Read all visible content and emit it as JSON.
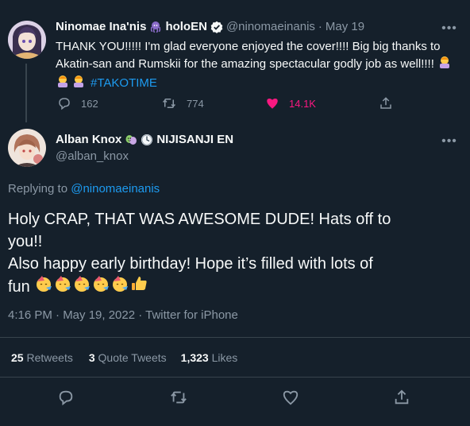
{
  "parent_tweet": {
    "display_name": "Ninomae Ina'nis",
    "name_suffix": "holoEN",
    "handle": "@ninomaeinanis",
    "date": "May 19",
    "text_line1": "THANK YOU!!!!! I'm glad everyone enjoyed the cover!!!! Big big thanks to",
    "text_line2": "Akatin-san and Rumskii for the amazing spectacular godly job as well!!!!",
    "hashtag": "#TAKOTIME",
    "replies": "162",
    "retweets": "774",
    "likes": "14.1K"
  },
  "reply_tweet": {
    "display_name": "Alban Knox",
    "name_suffix": "NIJISANJI EN",
    "handle": "@alban_knox",
    "replying_to_label": "Replying to",
    "replying_to_handle": "@ninomaeinanis",
    "text_line1": "Holy CRAP, THAT WAS AWESOME DUDE! Hats off to",
    "text_line2": "you!!",
    "text_line3": "Also happy early birthday! Hope it’s filled with lots of",
    "text_line4": "fun",
    "timestamp": "4:16 PM · May 19, 2022 · Twitter for iPhone",
    "retweets_count": "25",
    "retweets_label": "Retweets",
    "quote_count": "3",
    "quote_label": "Quote Tweets",
    "likes_count": "1,323",
    "likes_label": "Likes"
  },
  "colors": {
    "background": "#15202b",
    "accent": "#1d9bf0",
    "like_active": "#f91880",
    "muted": "#8b98a5",
    "divider": "#38444d"
  }
}
